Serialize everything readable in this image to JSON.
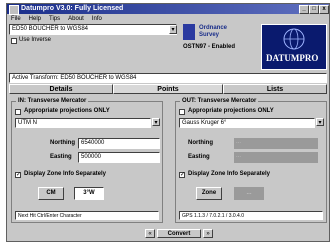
{
  "window": {
    "title": "Datumpro V3.0: Fully Licensed",
    "min_glyph": "_",
    "max_glyph": "□",
    "close_glyph": "x"
  },
  "menu": [
    "File",
    "Help",
    "Tips",
    "About",
    "Info"
  ],
  "transform_select": {
    "value": "ED50 BOUCHER to WGS84",
    "arrow": "▾"
  },
  "inverse_checkbox": {
    "checked": false,
    "label": "Use Inverse"
  },
  "survey_logo": {
    "line1": "Ordnance",
    "line2": "Survey",
    "line3": "OSTN97 - Enabled"
  },
  "brand": "DATUMPRO",
  "active_transform": "Active Transform: ED50 BOUCHER to WGS84",
  "tabs": [
    {
      "label": "Details",
      "active": false
    },
    {
      "label": "Points",
      "active": true
    },
    {
      "label": "Lists",
      "active": false
    }
  ],
  "in_group": {
    "title": "IN: Transverse Mercator",
    "approx_checked": false,
    "approx_label": "Appropriate projections ONLY",
    "projection": "UTM N",
    "northing_label": "Northing",
    "northing_value": "6540000",
    "easting_label": "Easting",
    "easting_value": "500000",
    "display_checked": true,
    "display_label": "Display Zone Info Separately",
    "zone_button": "CM",
    "zone_value": "3°W",
    "status": "Next Hit Ctrl/Enter Character"
  },
  "out_group": {
    "title": "OUT: Transverse Mercator",
    "approx_checked": false,
    "approx_label": "Appropriate projections ONLY",
    "projection": "Gauss Kruger 6°",
    "northing_label": "Northing",
    "northing_value": "...",
    "easting_label": "Easting",
    "easting_value": "...",
    "display_checked": true,
    "display_label": "Display Zone Info Separately",
    "zone_button": "Zone",
    "zone_value": "...",
    "status": "GPS 1.1.3 / 7.0.2.1 / 3.0.4.0"
  },
  "convert_button": "Convert",
  "nav": {
    "left": "«",
    "right": "»"
  }
}
